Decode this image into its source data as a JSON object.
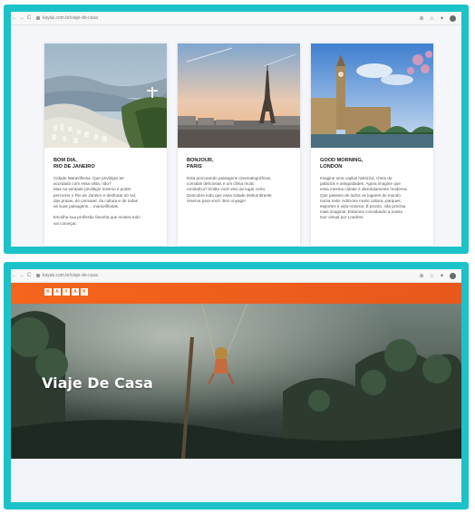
{
  "browser": {
    "back": "←",
    "forward": "→",
    "reload": "C",
    "url": "kayak.com.br/viaje-de-casa"
  },
  "cards": [
    {
      "title": "BOM DIA,\nRIO DE JANEIRO",
      "body": "Cidade Maravilhosa. Que privilégio ter\nacordado com essa vista, não?\nMas na verdade privilégio mesmo é poder\npercorrer o Rio de Janeiro e desfrutar do sol,\ndas praias, do carnaval, da cultura e de todas\nas suas paisagens… maravilhosas.\n\nEscolha sua profissão favorita que mostra tudo\nvai começar."
    },
    {
      "title": "BONJOUR,\nPARIS",
      "body": "Está procurando paisagens cinematográficas,\ncomidas deliciosas e um clima muito\nromântico? Então você veio ao lugar certo.\nDescubra tudo que essa cidade deslumbrante\nreserva para você. Bon voyage!"
    },
    {
      "title": "GOOD MORNING,\nLONDON",
      "body": "Imagine uma capital histórica, cheia de\npalácios e antiguidades. Agora imagine que\nessa mesma cidade é absolutamente moderna.\nQue passeia de todos os lugares do mundo\nnuma rede. Adicione muito cultura, parques,\nesportes e vida noturna. É pronto, não precisa\nmais imaginar. Estamos convidando a nossa\ntour virtual por Londres."
    }
  ],
  "logo_letters": [
    "K",
    "A",
    "Y",
    "A",
    "K"
  ],
  "hero": {
    "title": "Viaje De Casa"
  },
  "colors": {
    "frame": "#1cc2c9",
    "brand": "#f5651c"
  }
}
